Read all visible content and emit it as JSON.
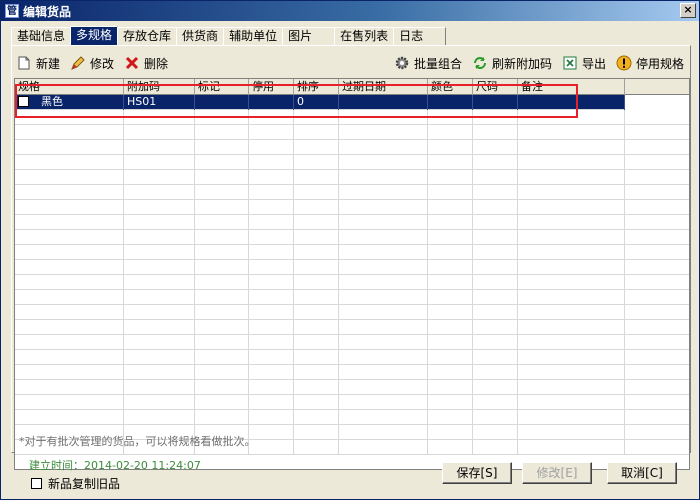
{
  "window": {
    "title": "编辑货品",
    "title_icon": "管",
    "close": "×"
  },
  "tabs": [
    "基础信息",
    "多规格",
    "存放仓库",
    "供货商",
    "辅助单位",
    "图片",
    "在售列表",
    "日志"
  ],
  "toolbar": {
    "new": "新建",
    "edit": "修改",
    "delete": "删除",
    "batch": "批量组合",
    "refresh": "刷新附加码",
    "export": "导出",
    "disable": "停用规格"
  },
  "grid": {
    "columns": [
      "规格",
      "附加码",
      "标记",
      "停用",
      "排序",
      "过期日期",
      "颜色",
      "尺码",
      "备注",
      ""
    ],
    "rows": [
      [
        "黑色",
        "HS01",
        "",
        "",
        "0",
        "",
        "",
        "",
        "",
        ""
      ]
    ]
  },
  "note": "*对于有批次管理的货品，可以将规格看做批次。",
  "created": "建立时间：2014-02-20 11:24:07",
  "copy_label": "新品复制旧品",
  "buttons": {
    "save": "保存[S]",
    "edit": "修改[E]",
    "cancel": "取消[C]"
  }
}
